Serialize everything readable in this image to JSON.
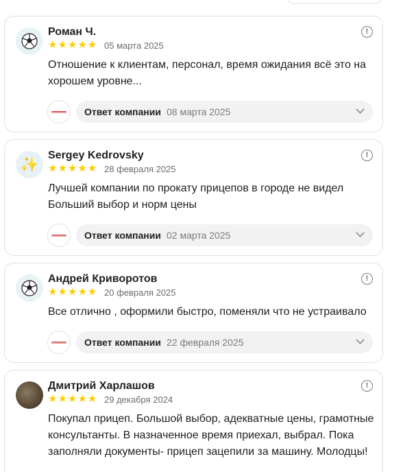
{
  "reviews": [
    {
      "avatar": "soccer-ball",
      "name": "Роман Ч.",
      "stars": "★★★★★",
      "date": "05 марта 2025",
      "text": "Отношение к клиентам, персонал, время ожидания всё это на хорошем уровне...",
      "reply_label": "Ответ компании",
      "reply_date": "08 марта 2025"
    },
    {
      "avatar": "sparkles",
      "name": "Sergey Kedrovsky",
      "stars": "★★★★★",
      "date": "28 февраля 2025",
      "text": "Лучшей компании по прокату прицепов в городе не видел Больший выбор и норм цены",
      "reply_label": "Ответ компании",
      "reply_date": "02 марта 2025"
    },
    {
      "avatar": "soccer-ball",
      "name": "Андрей Криворотов",
      "stars": "★★★★★",
      "date": "20 февраля 2025",
      "text": "Все отлично , оформили быстро, поменяли что не устраивало",
      "reply_label": "Ответ компании",
      "reply_date": "22 февраля 2025"
    },
    {
      "avatar": "photo",
      "name": "Дмитрий Харлашов",
      "stars": "★★★★★",
      "date": "29 декабря 2024",
      "text": "Покупал прицеп. Большой выбор, адекватные цены, грамотные консультанты. В назначенное время приехал, выбрал. Пока заполняли документы- прицеп зацепили за машину. Молодцы!"
    }
  ],
  "colors": {
    "star": "#ffcc00",
    "reply_bg": "#f2f2f2",
    "border": "#e1e1e1"
  }
}
